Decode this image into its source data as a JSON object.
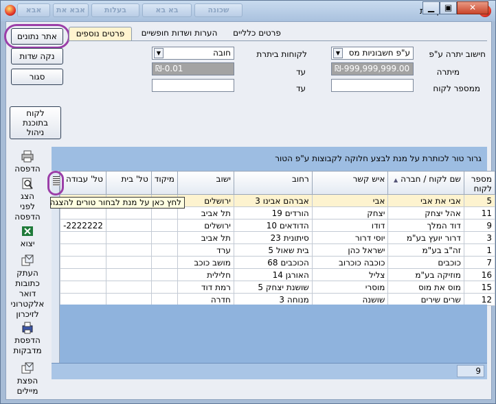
{
  "window": {
    "title": "דו\"ח לקוחות",
    "ghost_buttons": [
      "אבא",
      "אבא את",
      "בעלות",
      "בא בא",
      "שכונה"
    ]
  },
  "actions": {
    "search_label": "אתר נתונים",
    "clear_label": "נקה שדות",
    "close_label": "סגור",
    "managed_customers_label": "לקוח\nבתוכנת\nניהול"
  },
  "tabs": [
    {
      "label": "פרטים כלליים"
    },
    {
      "label": "הערות ושדות חופשיים"
    },
    {
      "label": "פרטים נוספים"
    }
  ],
  "filters": {
    "calc_balance_label": "חישוב יתרה ע\"פ",
    "calc_balance_value": "ע\"פ חשבוניות מס",
    "customers_in_balance_label": "לקוחות ביתרת",
    "customers_in_balance_value": "חובה",
    "balance_label": "מיתרה",
    "balance_from_value": "₪-999,999,999.00",
    "until_label": "עד",
    "balance_to_value": "₪-0.01",
    "customer_number_label": "ממספר לקוח",
    "until_label_2": "עד",
    "customer_from_value": "",
    "customer_to_value": ""
  },
  "toolbar": [
    {
      "label": "הדפסה",
      "icon": "printer-icon"
    },
    {
      "label": "הצג\nלפני\nהדפסה",
      "icon": "print-preview-icon"
    },
    {
      "label": "יצוא",
      "icon": "excel-icon"
    },
    {
      "label": "העתק\nכתובות\nדואר\nאלקטרוני\nלזיכרון",
      "icon": "copy-emails-icon"
    },
    {
      "label": "הדפסת\nמדבקות",
      "icon": "label-printer-icon"
    },
    {
      "label": "הפצת\nמיילים",
      "icon": "mail-send-icon"
    }
  ],
  "grid": {
    "group_hint": "גרור טור לכותרת על מנת לבצע חלוקה לקבוצות ע\"פ הטור",
    "columns": [
      "מספר\nלקוח",
      "שם לקוח / חברה",
      "איש קשר",
      "רחוב",
      "ישוב",
      "מיקוד",
      "טל' בית",
      "טל' עבודה"
    ],
    "rows": [
      [
        "5",
        "אבי את אבי",
        "אבי",
        "אברהם אבינו 3",
        "ירושלים",
        "",
        "",
        ""
      ],
      [
        "11",
        "אהל יצחק",
        "יצחק",
        "הורדים 19",
        "תל אביב",
        "",
        "",
        ""
      ],
      [
        "9",
        "דוד המלך",
        "דודו",
        "הדודאים 10",
        "ירושלים",
        "",
        "",
        "2222222-"
      ],
      [
        "3",
        "דרור יועץ בע\"מ",
        "יוסי דרור",
        "סיתונית 23",
        "תל אביב",
        "",
        "",
        ""
      ],
      [
        "1",
        "זה\"ב בע\"מ",
        "ישראל כהן",
        "בית שאול 5",
        "ערד",
        "",
        "",
        ""
      ],
      [
        "7",
        "כוכבים",
        "כוכבה כוכרוב",
        "הכוכבים 68",
        "מושב כוכב",
        "",
        "",
        ""
      ],
      [
        "16",
        "מוזיקה בע\"מ",
        "צליל",
        "האורגן 14",
        "חלילית",
        "",
        "",
        ""
      ],
      [
        "15",
        "מוס את מוס",
        "מוסרי",
        "שושנת יצחק 5",
        "רמת דוד",
        "",
        "",
        ""
      ],
      [
        "12",
        "שרים שירים",
        "שושנה",
        "מנוחה 3",
        "חדרה",
        "",
        "",
        ""
      ]
    ],
    "column_chooser_tooltip": "לחץ כאן על מנת לבחור טורים להצגה",
    "record_count": "9"
  },
  "colors": {
    "accent_ring": "#9b3ea8",
    "selected_row": "#fdf3cf",
    "active_tab": "#fff4cf"
  }
}
